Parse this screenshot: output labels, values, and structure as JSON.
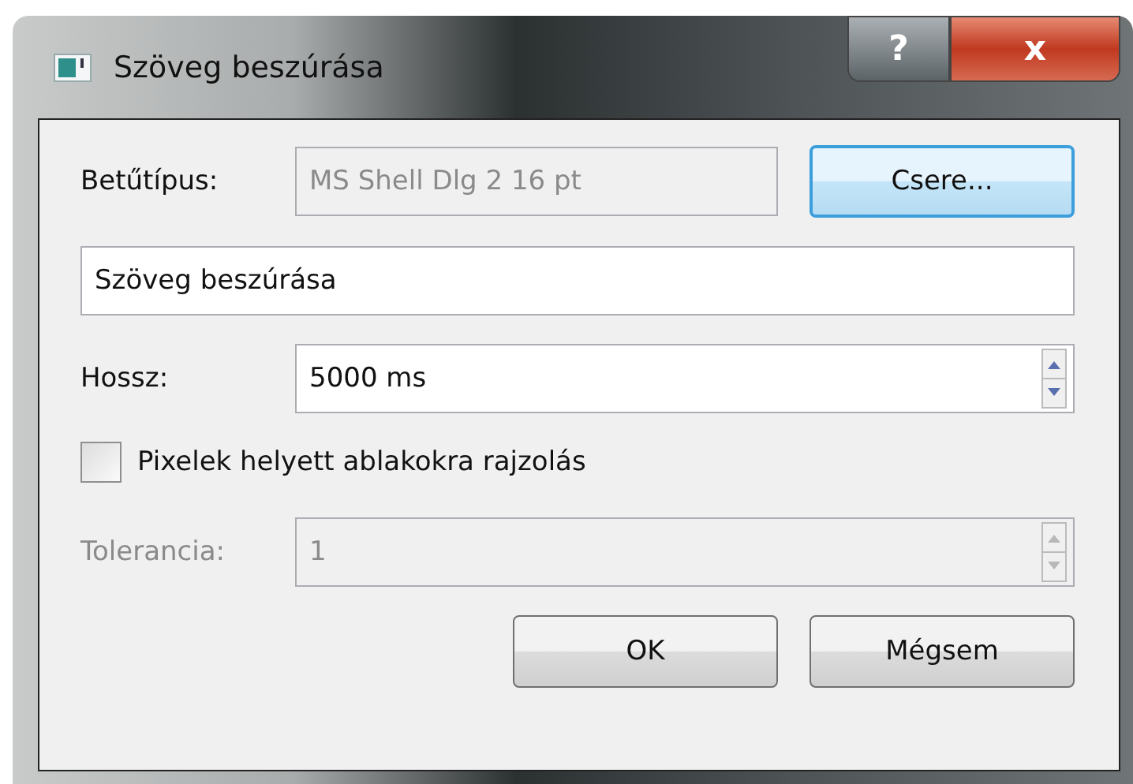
{
  "window": {
    "title": "Szöveg beszúrása",
    "help_button": "?",
    "close_button": "x"
  },
  "font": {
    "label": "Betűtípus:",
    "value": "MS Shell Dlg 2 16 pt",
    "disabled": true,
    "button": "Csere..."
  },
  "text": {
    "value": "Szöveg beszúrása"
  },
  "length": {
    "label": "Hossz:",
    "value": "5000 ms",
    "disabled": false
  },
  "draw_on_windows": {
    "label": "Pixelek helyett ablakokra rajzolás",
    "checked": false
  },
  "tolerance": {
    "label": "Tolerancia:",
    "value": "1",
    "disabled": true
  },
  "buttons": [
    {
      "label": "OK"
    },
    {
      "label": "Mégsem"
    }
  ]
}
